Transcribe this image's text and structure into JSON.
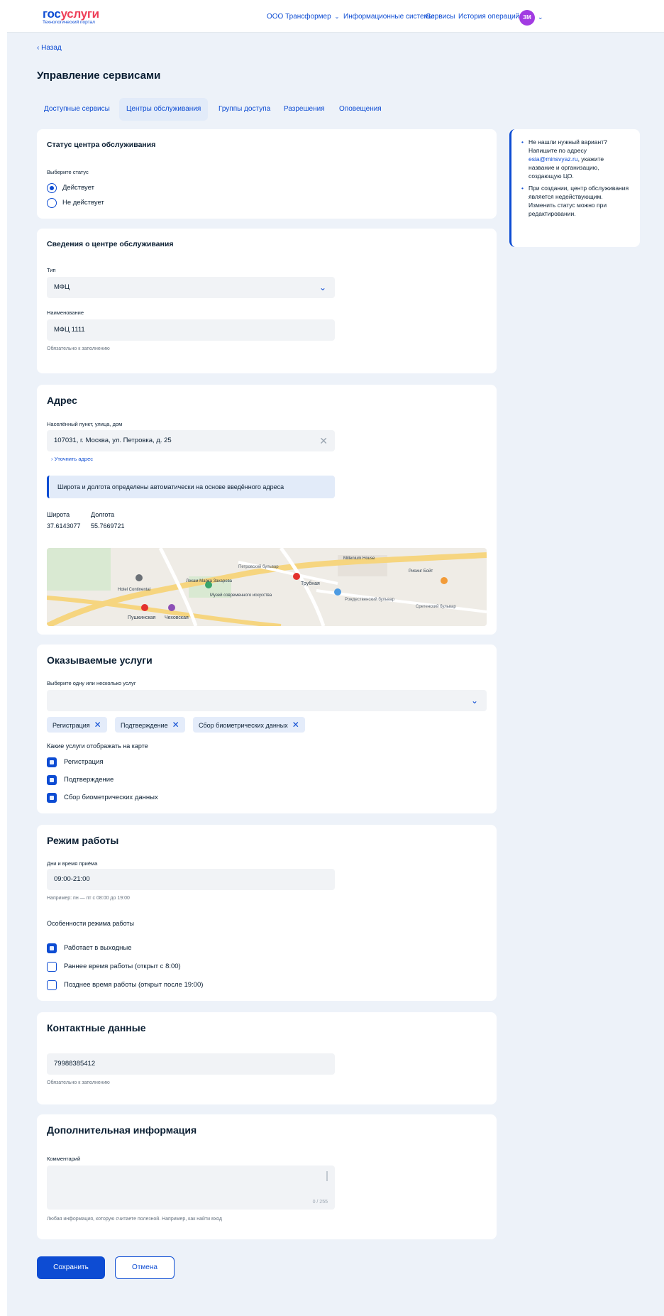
{
  "header": {
    "logo_main_1": "гос",
    "logo_main_2": "услуги",
    "logo_sub": "Технологический портал",
    "org_selector": "ООО Трансформер",
    "nav": [
      "Информационные системы",
      "Сервисы",
      "История операций"
    ],
    "avatar_initials": "ЗМ"
  },
  "back_label": "Назад",
  "page_title": "Управление сервисами",
  "tabs": [
    {
      "label": "Доступные сервисы",
      "active": false
    },
    {
      "label": "Центры обслуживания",
      "active": true
    },
    {
      "label": "Группы доступа",
      "active": false
    },
    {
      "label": "Разрешения",
      "active": false
    },
    {
      "label": "Оповещения",
      "active": false
    }
  ],
  "status": {
    "title": "Статус центра обслуживания",
    "choose_label": "Выберите статус",
    "options": [
      {
        "label": "Действует",
        "selected": true
      },
      {
        "label": "Не действует",
        "selected": false
      }
    ]
  },
  "info": {
    "title": "Сведения о центре обслуживания",
    "type_label": "Тип",
    "type_value": "МФЦ",
    "name_label": "Наименование",
    "name_value": "МФЦ 1111",
    "required_hint": "Обязательно к заполнению"
  },
  "address": {
    "title": "Адрес",
    "field_label": "Населённый пункт, улица, дом",
    "field_value": "107031, г. Москва, ул. Петровка, д. 25",
    "refine_link": "Уточнить адрес",
    "banner": "Широта и долгота определены автоматически на основе введённого адреса",
    "lat_label": "Широта",
    "lat_value": "37.6143077",
    "lon_label": "Долгота",
    "lon_value": "55.7669721",
    "map_labels": [
      "Трубная",
      "Пушкинская",
      "Чеховская",
      "Hotel Continental",
      "Петровский бульвар",
      "Рождественский бульвар",
      "Сретенский бульвар",
      "Millenium House",
      "Рисинг Бойт",
      "Музей современного искусства",
      "Лекам Марка Захарова"
    ]
  },
  "services": {
    "title": "Оказываемые услуги",
    "select_label": "Выберите одну или несколько услуг",
    "chips": [
      "Регистрация",
      "Подтверждение",
      "Сбор биометрических данных"
    ],
    "map_question": "Какие услуги отображать на карте",
    "map_checks": [
      {
        "label": "Регистрация",
        "checked": true
      },
      {
        "label": "Подтверждение",
        "checked": true
      },
      {
        "label": "Сбор биометрических данных",
        "checked": true
      }
    ]
  },
  "schedule": {
    "title": "Режим работы",
    "field_label": "Дни и время приёма",
    "field_value": "09:00-21:00",
    "field_hint": "Например: пн — пт с 08:00 до 19:00",
    "features_label": "Особенности режима работы",
    "features": [
      {
        "label": "Работает в выходные",
        "checked": true
      },
      {
        "label": "Раннее время работы (открыт с 8:00)",
        "checked": false
      },
      {
        "label": "Позднее время работы (открыт после 19:00)",
        "checked": false
      }
    ]
  },
  "contacts": {
    "title": "Контактные данные",
    "phone_value": "79988385412",
    "required_hint": "Обязательно к заполнению"
  },
  "extra": {
    "title": "Дополнительная информация",
    "comment_label": "Комментарий",
    "counter": "0 / 255",
    "hint": "Любая информация, которую считаете полезной. Например, как найти вход"
  },
  "sidebox": {
    "item1_a": "Не нашли нужный вариант? Напишите по адресу ",
    "item1_email": "esia@minsvyaz.ru",
    "item1_b": ", укажите название и организацию, создающую ЦО.",
    "item2": "При создании, центр обслуживания является недействующим. Изменить статус можно при редактировании."
  },
  "buttons": {
    "save": "Сохранить",
    "cancel": "Отмена"
  },
  "colors": {
    "primary": "#0d4cd3",
    "brand_red": "#ee3f58",
    "background": "#edf2f9",
    "avatar": "#a23be2"
  }
}
